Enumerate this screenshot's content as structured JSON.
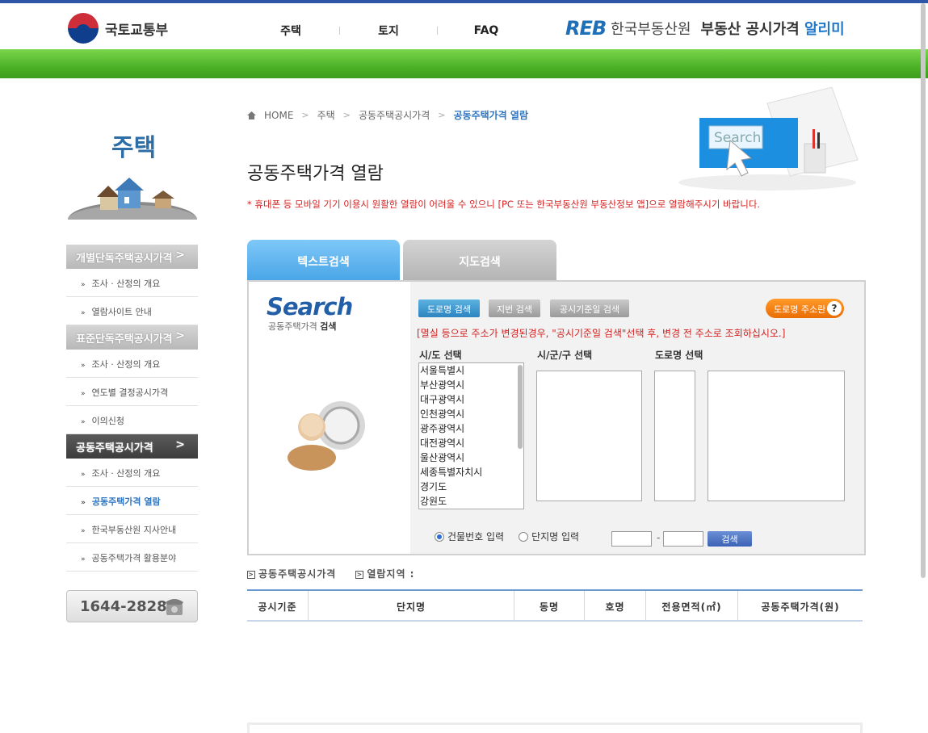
{
  "header": {
    "molit_logo": "국토교통부",
    "nav": [
      "주택",
      "토지",
      "FAQ"
    ],
    "reb_mark": "REB",
    "reb_name": "한국부동산원",
    "site_title_a": "부동산 공시가격",
    "site_title_b": "알리미"
  },
  "sidebar": {
    "title": "주택",
    "groups": [
      {
        "label": "개별단독주택공시가격",
        "items": [
          "조사 · 산정의 개요",
          "열람사이트 안내"
        ]
      },
      {
        "label": "표준단독주택공시가격",
        "items": [
          "조사 · 산정의 개요",
          "연도별 결정공시가격",
          "이의신청"
        ]
      },
      {
        "label": "공동주택공시가격",
        "items": [
          "조사 · 산정의 개요",
          "공동주택가격 열람",
          "한국부동산원 지사안내",
          "공동주택가격 활용분야"
        ]
      }
    ],
    "phone": "1644-2828"
  },
  "breadcrumb": [
    "HOME",
    "주택",
    "공동주택공시가격",
    "공동주택가격 열람"
  ],
  "page_title": "공동주택가격 열람",
  "notice": "* 휴대폰 등 모바일 기기 이용시 원활한 열람이 어려울 수 있으니 [PC 또는 한국부동산원 부동산정보 앱]으로 열람해주시기 바랍니다.",
  "hero_search_text": "Search",
  "tabs": [
    "텍스트검색",
    "지도검색"
  ],
  "search_panel": {
    "logo": "Search",
    "sub_a": "공동주택가격",
    "sub_b": "검색",
    "buttons": [
      "도로명 검색",
      "지번 검색",
      "공시기준일 검색"
    ],
    "addr_button": "도로명 주소란",
    "addr_help": "?",
    "warning": "[멸실 등으로 주소가 변경된경우, \"공시기준일 검색\"선택 후, 변경 전 주소로 조회하십시오.]",
    "labels": [
      "시/도 선택",
      "시/군/구 선택",
      "도로명 선택"
    ],
    "sido_options": [
      "서울특별시",
      "부산광역시",
      "대구광역시",
      "인천광역시",
      "광주광역시",
      "대전광역시",
      "울산광역시",
      "세종특별자치시",
      "경기도",
      "강원도"
    ],
    "radio_building": "건물번호 입력",
    "radio_complex": "단지명 입력",
    "dash": "-",
    "search_button": "검색"
  },
  "result_info": [
    "공동주택공시가격",
    "열람지역 :"
  ],
  "table_headers": [
    "공시기준",
    "단지명",
    "동명",
    "호명",
    "전용면적(㎡)",
    "공동주택가격(원)"
  ],
  "colors": {
    "accent_blue": "#2d75c2",
    "green_bar": "#4cb228",
    "notice_red": "#d42020"
  }
}
